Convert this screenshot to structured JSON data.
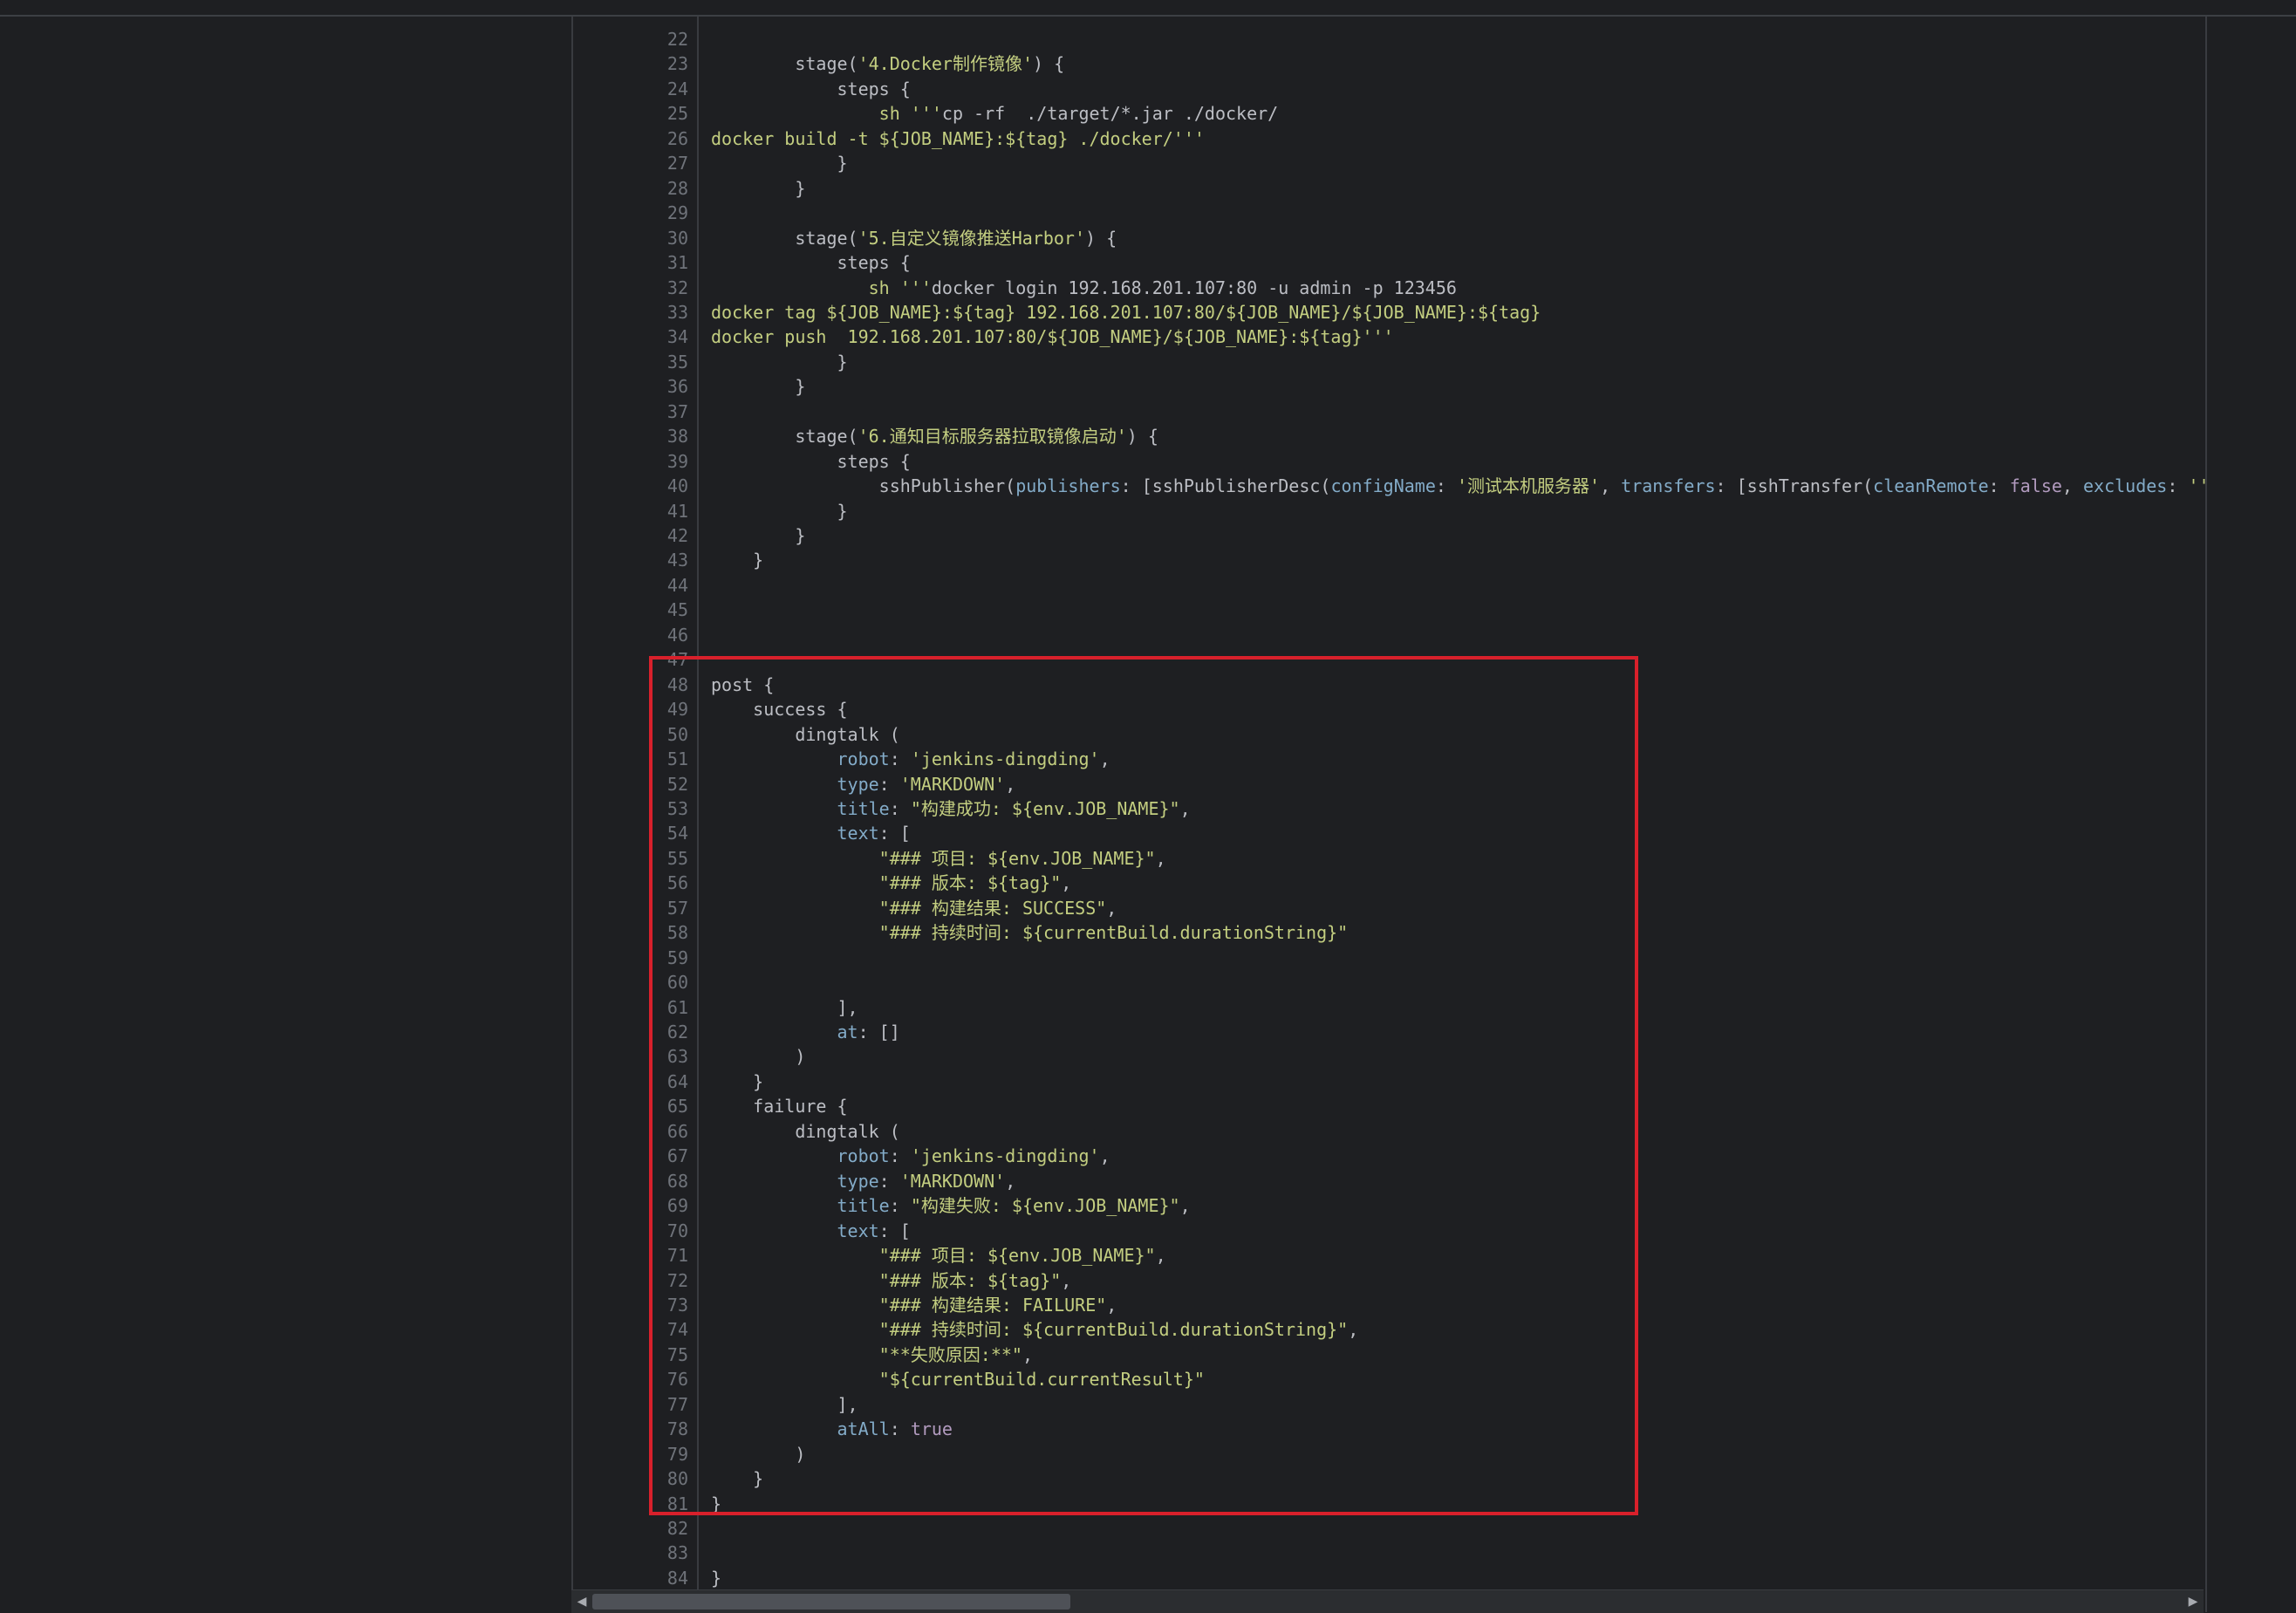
{
  "editor": {
    "lines": [
      {
        "n": "22",
        "c": ""
      },
      {
        "n": "23",
        "c": "        stage('4.Docker制作镜像') {"
      },
      {
        "n": "24",
        "c": "            steps {"
      },
      {
        "n": "25",
        "c": "                sh '''cp -rf  ./target/*.jar ./docker/"
      },
      {
        "n": "26",
        "c": "docker build -t ${JOB_NAME}:${tag} ./docker/'''"
      },
      {
        "n": "27",
        "c": "            }"
      },
      {
        "n": "28",
        "c": "        }"
      },
      {
        "n": "29",
        "c": ""
      },
      {
        "n": "30",
        "c": "        stage('5.自定义镜像推送Harbor') {"
      },
      {
        "n": "31",
        "c": "            steps {"
      },
      {
        "n": "32",
        "c": "               sh '''docker login 192.168.201.107:80 -u admin -p 123456"
      },
      {
        "n": "33",
        "c": "docker tag ${JOB_NAME}:${tag} 192.168.201.107:80/${JOB_NAME}/${JOB_NAME}:${tag}"
      },
      {
        "n": "34",
        "c": "docker push  192.168.201.107:80/${JOB_NAME}/${JOB_NAME}:${tag}'''"
      },
      {
        "n": "35",
        "c": "            }"
      },
      {
        "n": "36",
        "c": "        }"
      },
      {
        "n": "37",
        "c": ""
      },
      {
        "n": "38",
        "c": "        stage('6.通知目标服务器拉取镜像启动') {"
      },
      {
        "n": "39",
        "c": "            steps {"
      },
      {
        "n": "40",
        "c": "                sshPublisher(publishers: [sshPublisherDesc(configName: '测试本机服务器', transfers: [sshTransfer(cleanRemote: false, excludes: '', ex"
      },
      {
        "n": "41",
        "c": "            }"
      },
      {
        "n": "42",
        "c": "        }"
      },
      {
        "n": "43",
        "c": "    }"
      },
      {
        "n": "44",
        "c": ""
      },
      {
        "n": "45",
        "c": ""
      },
      {
        "n": "46",
        "c": ""
      },
      {
        "n": "47",
        "c": ""
      },
      {
        "n": "48",
        "c": "post {"
      },
      {
        "n": "49",
        "c": "    success {"
      },
      {
        "n": "50",
        "c": "        dingtalk ("
      },
      {
        "n": "51",
        "c": "            robot: 'jenkins-dingding',"
      },
      {
        "n": "52",
        "c": "            type: 'MARKDOWN',"
      },
      {
        "n": "53",
        "c": "            title: \"构建成功: ${env.JOB_NAME}\","
      },
      {
        "n": "54",
        "c": "            text: ["
      },
      {
        "n": "55",
        "c": "                \"### 项目: ${env.JOB_NAME}\","
      },
      {
        "n": "56",
        "c": "                \"### 版本: ${tag}\","
      },
      {
        "n": "57",
        "c": "                \"### 构建结果: SUCCESS\","
      },
      {
        "n": "58",
        "c": "                \"### 持续时间: ${currentBuild.durationString}\""
      },
      {
        "n": "59",
        "c": ""
      },
      {
        "n": "60",
        "c": ""
      },
      {
        "n": "61",
        "c": "            ],"
      },
      {
        "n": "62",
        "c": "            at: []"
      },
      {
        "n": "63",
        "c": "        )"
      },
      {
        "n": "64",
        "c": "    }"
      },
      {
        "n": "65",
        "c": "    failure {"
      },
      {
        "n": "66",
        "c": "        dingtalk ("
      },
      {
        "n": "67",
        "c": "            robot: 'jenkins-dingding',"
      },
      {
        "n": "68",
        "c": "            type: 'MARKDOWN',"
      },
      {
        "n": "69",
        "c": "            title: \"构建失败: ${env.JOB_NAME}\","
      },
      {
        "n": "70",
        "c": "            text: ["
      },
      {
        "n": "71",
        "c": "                \"### 项目: ${env.JOB_NAME}\","
      },
      {
        "n": "72",
        "c": "                \"### 版本: ${tag}\","
      },
      {
        "n": "73",
        "c": "                \"### 构建结果: FAILURE\","
      },
      {
        "n": "74",
        "c": "                \"### 持续时间: ${currentBuild.durationString}\","
      },
      {
        "n": "75",
        "c": "                \"**失败原因:**\","
      },
      {
        "n": "76",
        "c": "                \"${currentBuild.currentResult}\""
      },
      {
        "n": "77",
        "c": "            ],"
      },
      {
        "n": "78",
        "c": "            atAll: true"
      },
      {
        "n": "79",
        "c": "        )"
      },
      {
        "n": "80",
        "c": "    }"
      },
      {
        "n": "81",
        "c": "}"
      },
      {
        "n": "82",
        "c": ""
      },
      {
        "n": "83",
        "c": ""
      },
      {
        "n": "84",
        "c": "}"
      }
    ]
  },
  "highlight": {
    "color": "#d8202b"
  },
  "scrollbar": {
    "left_arrow": "◀",
    "right_arrow": "▶"
  }
}
